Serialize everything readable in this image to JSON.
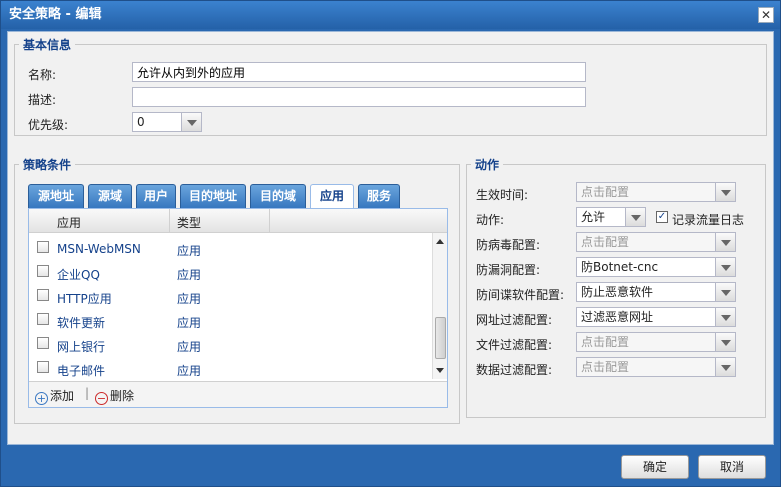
{
  "window": {
    "title": "安全策略 - 编辑"
  },
  "basic": {
    "legend": "基本信息",
    "name_label": "名称:",
    "name_value": "允许从内到外的应用",
    "desc_label": "描述:",
    "desc_value": "",
    "priority_label": "优先级:",
    "priority_value": "0"
  },
  "conditions": {
    "legend": "策略条件",
    "tabs": [
      "源地址",
      "源域",
      "用户",
      "目的地址",
      "目的域",
      "应用",
      "服务"
    ],
    "active_tab": "应用",
    "columns": [
      "应用",
      "类型"
    ],
    "rows": [
      {
        "name": "MSN-WebMSN",
        "type": "应用"
      },
      {
        "name": "企业QQ",
        "type": "应用"
      },
      {
        "name": "HTTP应用",
        "type": "应用"
      },
      {
        "name": "软件更新",
        "type": "应用"
      },
      {
        "name": "网上银行",
        "type": "应用"
      },
      {
        "name": "电子邮件",
        "type": "应用"
      }
    ],
    "add_label": "添加",
    "delete_label": "删除"
  },
  "action": {
    "legend": "动作",
    "fields": [
      {
        "label": "生效时间:",
        "value": "点击配置",
        "disabled": true
      },
      {
        "label": "动作:",
        "value": "允许",
        "disabled": false
      },
      {
        "label": "防病毒配置:",
        "value": "点击配置",
        "disabled": true
      },
      {
        "label": "防漏洞配置:",
        "value": "防Botnet-cnc",
        "disabled": false
      },
      {
        "label": "防间谍软件配置:",
        "value": "防止恶意软件",
        "disabled": false
      },
      {
        "label": "网址过滤配置:",
        "value": "过滤恶意网址",
        "disabled": false
      },
      {
        "label": "文件过滤配置:",
        "value": "点击配置",
        "disabled": true
      },
      {
        "label": "数据过滤配置:",
        "value": "点击配置",
        "disabled": true
      }
    ],
    "log_label": "记录流量日志",
    "log_checked": true
  },
  "footer": {
    "ok_label": "确定",
    "cancel_label": "取消"
  },
  "colors": {
    "title_bar": "#2461a8",
    "tab_active_text": "#15428b",
    "link_text": "#15428b"
  }
}
